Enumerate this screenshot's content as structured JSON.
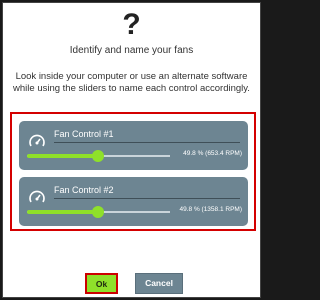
{
  "dialog": {
    "icon_text": "?",
    "subtitle": "Identify and name your fans",
    "instructions": "Look inside your computer or use an alternate software while using the sliders to name each control accordingly."
  },
  "controls": [
    {
      "label": "Fan Control #1",
      "percent": 49.8,
      "readout": "49.8 % (653.4 RPM)"
    },
    {
      "label": "Fan Control #2",
      "percent": 49.8,
      "readout": "49.8 % (1358.1 RPM)"
    }
  ],
  "buttons": {
    "ok_label": "Ok",
    "cancel_label": "Cancel"
  },
  "colors": {
    "card_bg": "#6d8592",
    "accent_green": "#8fe02a",
    "highlight_red": "#d40000"
  },
  "icons": {
    "question": "question-mark-icon",
    "fan": "gauge-icon"
  }
}
